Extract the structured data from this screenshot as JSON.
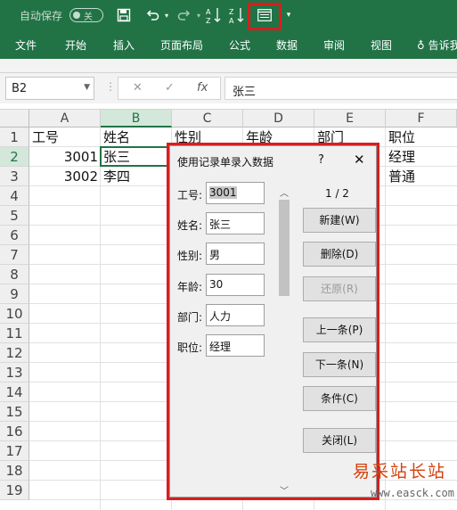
{
  "quick_access": {
    "autosave_label": "自动保存",
    "autosave_state": "关",
    "icons": [
      "save-icon",
      "undo-icon",
      "redo-icon",
      "sort-ascending-icon",
      "sort-descending-icon",
      "form-icon",
      "customize-icon"
    ]
  },
  "ribbon": {
    "tabs": [
      "文件",
      "开始",
      "插入",
      "页面布局",
      "公式",
      "数据",
      "审阅",
      "视图"
    ],
    "tell_me": "告诉我"
  },
  "formula_bar": {
    "name_box": "B2",
    "cancel_glyph": "✕",
    "enter_glyph": "✓",
    "fx_glyph": "fx",
    "content": "张三"
  },
  "sheet": {
    "columns": [
      "A",
      "B",
      "C",
      "D",
      "E",
      "F"
    ],
    "rows": [
      "1",
      "2",
      "3",
      "4",
      "5",
      "6",
      "7",
      "8",
      "9",
      "10",
      "11",
      "12",
      "13",
      "14",
      "15",
      "16",
      "17",
      "18",
      "19"
    ],
    "cells": {
      "a1": "工号",
      "b1": "姓名",
      "c1": "性别",
      "d1": "年龄",
      "e1": "部门",
      "f1": "职位",
      "a2": "3001",
      "b2": "张三",
      "f2": "经理",
      "a3": "3002",
      "b3": "李四",
      "f3": "普通"
    }
  },
  "data_form": {
    "title": "使用记录单录入数据",
    "help": "?",
    "close": "✕",
    "record_counter": "1 / 2",
    "fields": [
      {
        "label": "工号:",
        "value": "3001"
      },
      {
        "label": "姓名:",
        "value": "张三"
      },
      {
        "label": "性别:",
        "value": "男"
      },
      {
        "label": "年龄:",
        "value": "30"
      },
      {
        "label": "部门:",
        "value": "人力"
      },
      {
        "label": "职位:",
        "value": "经理"
      }
    ],
    "buttons": {
      "new": "新建(W)",
      "delete": "删除(D)",
      "restore": "还原(R)",
      "prev": "上一条(P)",
      "next": "下一条(N)",
      "criteria": "条件(C)",
      "close": "关闭(L)"
    }
  },
  "watermark": {
    "chinese": "易采站长站",
    "url": "www.easck.com"
  },
  "colors": {
    "excel_green": "#217346",
    "highlight_red": "#d81e1e",
    "watermark_orange": "#d4420d"
  }
}
